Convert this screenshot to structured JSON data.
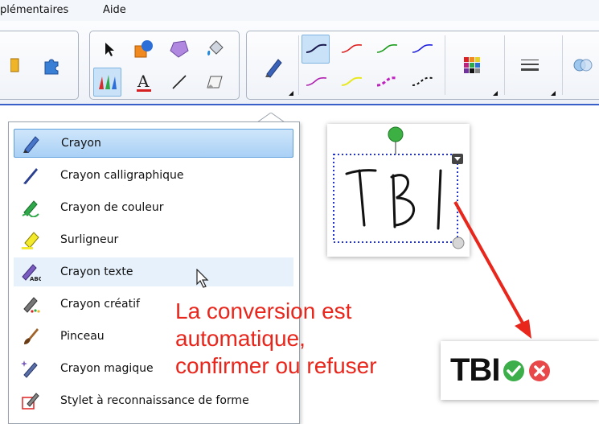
{
  "menubar": {
    "items": [
      "plémentaires",
      "Aide"
    ]
  },
  "toolbar": {
    "line_colors": [
      "#1a1a8f",
      "#e02020",
      "#1a9c1a",
      "#2020e0",
      "#b020b0",
      "#e8e820",
      "#c020c0",
      "#111111"
    ]
  },
  "dropdown": {
    "items": [
      {
        "label": "Crayon",
        "state": "selected"
      },
      {
        "label": "Crayon calligraphique"
      },
      {
        "label": "Crayon de couleur"
      },
      {
        "label": "Surligneur"
      },
      {
        "label": "Crayon texte",
        "state": "hover"
      },
      {
        "label": "Crayon créatif"
      },
      {
        "label": "Pinceau"
      },
      {
        "label": "Crayon magique"
      },
      {
        "label": "Stylet à reconnaissance de forme"
      }
    ]
  },
  "handwriting": {
    "text": "TBI"
  },
  "result": {
    "text": "TBI"
  },
  "annotation": {
    "line1": "La conversion est",
    "line2": "automatique,",
    "line3": "confirmer ou refuser"
  },
  "colors": {
    "accent": "#3a5fc9",
    "annotation": "#e8261c",
    "confirm": "#3cae4a",
    "reject": "#e8484a"
  }
}
